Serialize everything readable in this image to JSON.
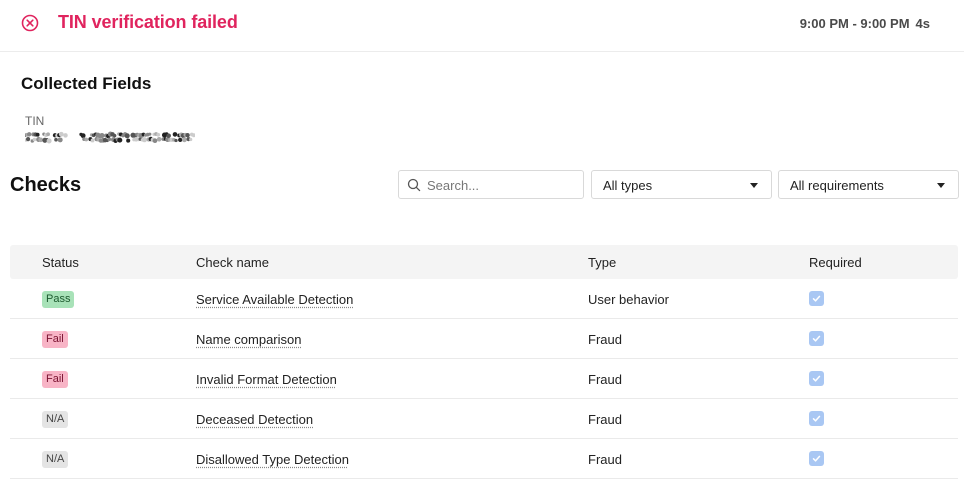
{
  "header": {
    "title": "TIN verification failed",
    "time_range": "9:00 PM - 9:00 PM",
    "duration": "4s",
    "status_color": "#e0245e"
  },
  "collected": {
    "title": "Collected Fields",
    "field_label": "TIN"
  },
  "checks": {
    "title": "Checks",
    "search_placeholder": "Search...",
    "type_filter": "All types",
    "requirement_filter": "All requirements",
    "columns": {
      "status": "Status",
      "name": "Check name",
      "type": "Type",
      "required": "Required"
    },
    "rows": [
      {
        "status": "Pass",
        "status_kind": "pass",
        "name": "Service Available Detection",
        "type": "User behavior",
        "required": true
      },
      {
        "status": "Fail",
        "status_kind": "fail",
        "name": "Name comparison",
        "type": "Fraud",
        "required": true
      },
      {
        "status": "Fail",
        "status_kind": "fail",
        "name": "Invalid Format Detection",
        "type": "Fraud",
        "required": true
      },
      {
        "status": "N/A",
        "status_kind": "na",
        "name": "Deceased Detection",
        "type": "Fraud",
        "required": true
      },
      {
        "status": "N/A",
        "status_kind": "na",
        "name": "Disallowed Type Detection",
        "type": "Fraud",
        "required": true
      }
    ]
  },
  "colors": {
    "pass_badge": "#a8e2b8",
    "fail_badge": "#f8b4c6",
    "na_badge": "#e4e4e4",
    "required_check": "#a9c7f3"
  }
}
